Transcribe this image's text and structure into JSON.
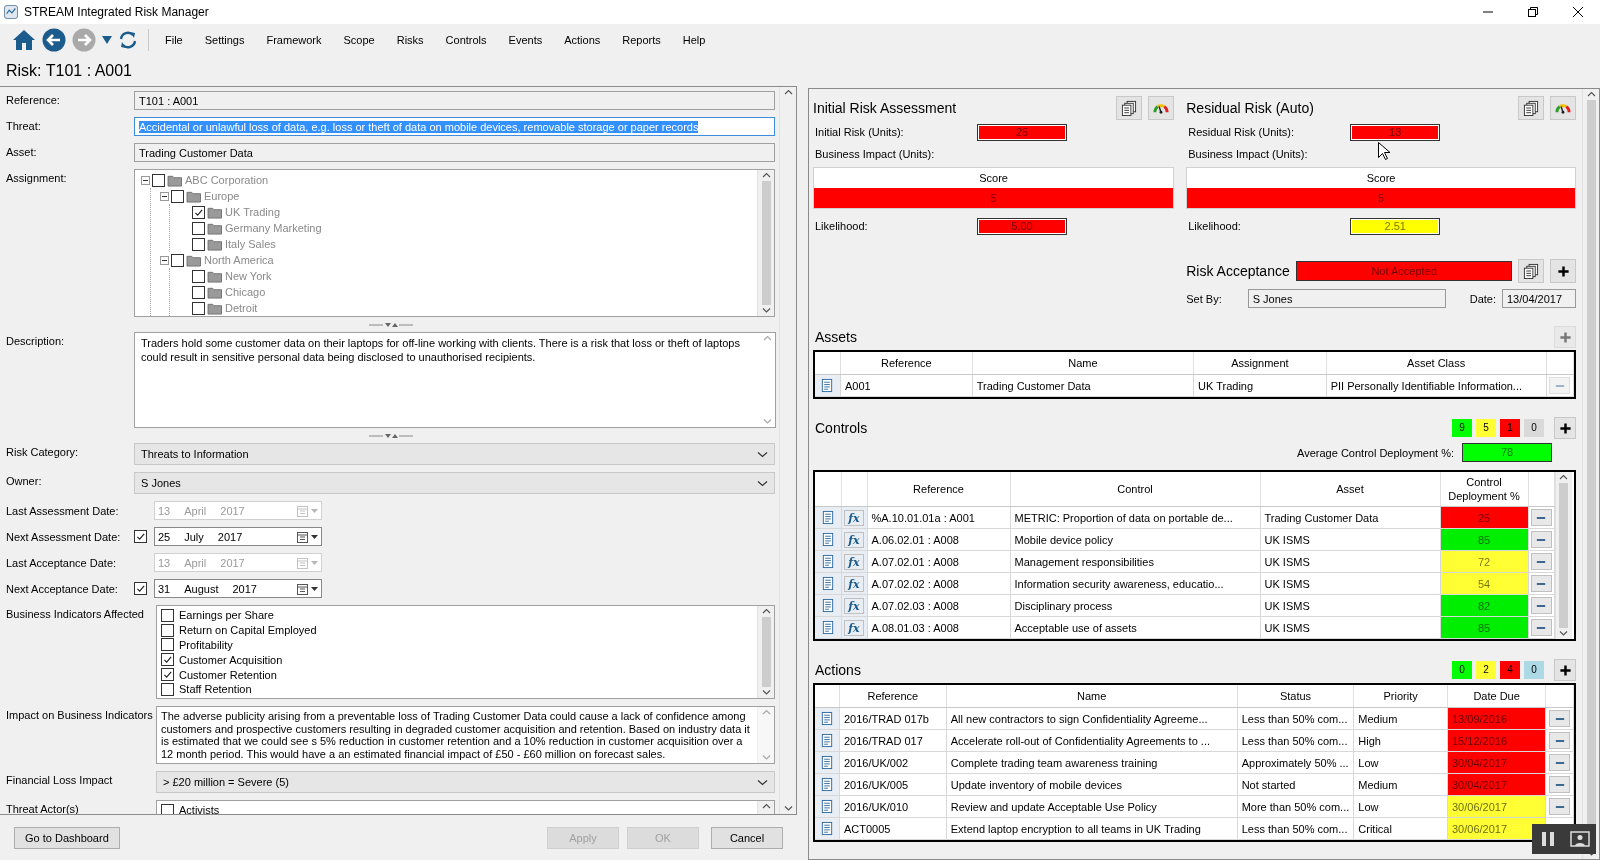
{
  "window": {
    "title": "STREAM Integrated Risk Manager"
  },
  "menu": [
    "File",
    "Settings",
    "Framework",
    "Scope",
    "Risks",
    "Controls",
    "Events",
    "Actions",
    "Reports",
    "Help"
  ],
  "page_title": "Risk: T101 : A001",
  "form": {
    "reference": {
      "label": "Reference:",
      "value": "T101 : A001"
    },
    "threat": {
      "label": "Threat:",
      "value": "Accidental or unlawful loss of data, e.g. loss or theft of data on mobile devices, removable storage or paper records",
      "selected": true
    },
    "asset": {
      "label": "Asset:",
      "value": "Trading Customer Data"
    },
    "assignment": {
      "label": "Assignment:",
      "tree": [
        {
          "label": "ABC Corporation",
          "checked": false,
          "expanded": true,
          "children": [
            {
              "label": "Europe",
              "checked": false,
              "expanded": true,
              "children": [
                {
                  "label": "UK Trading",
                  "checked": true
                },
                {
                  "label": "Germany Marketing",
                  "checked": false
                },
                {
                  "label": "Italy Sales",
                  "checked": false
                }
              ]
            },
            {
              "label": "North America",
              "checked": false,
              "expanded": true,
              "children": [
                {
                  "label": "New York",
                  "checked": false
                },
                {
                  "label": "Chicago",
                  "checked": false
                },
                {
                  "label": "Detroit",
                  "checked": false
                }
              ]
            }
          ]
        }
      ]
    },
    "description": {
      "label": "Description:",
      "value": "Traders hold some customer data on their laptops for off-line working with clients.  There is a risk that loss or theft of laptops could result in sensitive personal data being disclosed to unauthorised recipients."
    },
    "risk_category": {
      "label": "Risk Category:",
      "value": "Threats to Information"
    },
    "owner": {
      "label": "Owner:",
      "value": "S Jones"
    },
    "dates": [
      {
        "label": "Last Assessment Date:",
        "day": "13",
        "month": "April",
        "year": "2017",
        "disabled": true
      },
      {
        "label": "Next Assessment Date:",
        "day": "25",
        "month": "July",
        "year": "2017",
        "disabled": false,
        "checked": true
      },
      {
        "label": "Last Acceptance Date:",
        "day": "13",
        "month": "April",
        "year": "2017",
        "disabled": true
      },
      {
        "label": "Next Acceptance Date:",
        "day": "31",
        "month": "August",
        "year": "2017",
        "disabled": false,
        "checked": true
      }
    ],
    "business_indicators": {
      "label": "Business Indicators Affected",
      "items": [
        {
          "label": "Earnings per Share",
          "checked": false
        },
        {
          "label": "Return on Capital Employed",
          "checked": false
        },
        {
          "label": "Profitability",
          "checked": false
        },
        {
          "label": "Customer Acquisition",
          "checked": true
        },
        {
          "label": "Customer Retention",
          "checked": true
        },
        {
          "label": "Staff Retention",
          "checked": false
        }
      ]
    },
    "impact": {
      "label": "Impact on Business Indicators",
      "value": "The adverse publicity arising from a preventable loss of Trading Customer Data could cause a lack of confidence among customers and prospective customers resulting in degraded customer acquisition and retention.  Based on industry data it is estimated that we could see s 5% reduction in customer retention and a 10% reduction in customer acquisition over a 12 month period.  This would have a an estimated financial impact of £50 - £60 million on forecast sales."
    },
    "financial_loss": {
      "label": "Financial Loss Impact",
      "value": "> £20 million = Severe (5)"
    },
    "threat_actors": {
      "label": "Threat Actor(s)",
      "items": [
        {
          "label": "Activists",
          "checked": false
        }
      ]
    }
  },
  "footer_buttons": [
    {
      "label": "Go to Dashboard",
      "disabled": false
    },
    {
      "label": "Apply",
      "disabled": true
    },
    {
      "label": "OK",
      "disabled": true
    },
    {
      "label": "Cancel",
      "disabled": false
    }
  ],
  "assessments": [
    {
      "title": "Initial Risk Assessment",
      "risk_label": "Initial Risk (Units):",
      "risk": {
        "value": "25",
        "color": "#ff0000"
      },
      "impact_label": "Business Impact (Units):",
      "score_header": "Score",
      "score": {
        "value": "5",
        "color": "#ff0000"
      },
      "likelihood_label": "Likelihood:",
      "likelihood": {
        "value": "5.00",
        "color": "#ff0000"
      }
    },
    {
      "title": "Residual Risk (Auto)",
      "risk_label": "Residual Risk (Units):",
      "risk": {
        "value": "13",
        "color": "#ff0000"
      },
      "impact_label": "Business Impact (Units):",
      "score_header": "Score",
      "score": {
        "value": "5",
        "color": "#ff0000"
      },
      "likelihood_label": "Likelihood:",
      "likelihood": {
        "value": "2.51",
        "color": "#ffff00"
      }
    }
  ],
  "risk_acceptance": {
    "title": "Risk Acceptance",
    "status": {
      "value": "Not Accepted",
      "color": "#ff0000"
    },
    "set_by_label": "Set By:",
    "set_by": "S Jones",
    "date_label": "Date:",
    "date": "13/04/2017"
  },
  "assets": {
    "title": "Assets",
    "columns": [
      "Reference",
      "Name",
      "Assignment",
      "Asset Class"
    ],
    "rows": [
      {
        "cells": [
          "A001",
          "Trading Customer Data",
          "UK Trading",
          "PII Personally Identifiable Information..."
        ]
      }
    ]
  },
  "controls": {
    "title": "Controls",
    "counts": [
      {
        "value": "9",
        "color": "#00ff00"
      },
      {
        "value": "5",
        "color": "#ffff33"
      },
      {
        "value": "1",
        "color": "#ff0000"
      },
      {
        "value": "0",
        "color": "#d9d9d9"
      }
    ],
    "average_label": "Average Control Deployment %:",
    "average": {
      "value": "78",
      "color": "#00ff00"
    },
    "columns": [
      "Reference",
      "Control",
      "Asset",
      "Control Deployment %"
    ],
    "rows": [
      {
        "formula": "fx",
        "reference": "%A.10.01.01a : A001",
        "control": "METRIC: Proportion of data on portable de...",
        "asset": "Trading Customer Data",
        "deployment": "25",
        "color": "#ff0000"
      },
      {
        "formula": "fx",
        "reference": "A.06.02.01 : A008",
        "control": "Mobile device policy",
        "asset": "UK ISMS",
        "deployment": "85",
        "color": "#00ee00"
      },
      {
        "formula": "fx",
        "reference": "A.07.02.01 : A008",
        "control": "Management responsibilities",
        "asset": "UK ISMS",
        "deployment": "72",
        "color": "#ffff33"
      },
      {
        "formula": "fx",
        "reference": "A.07.02.02 : A008",
        "control": "Information security awareness, educatio...",
        "asset": "UK ISMS",
        "deployment": "54",
        "color": "#ffff33"
      },
      {
        "formula": "fx",
        "reference": "A.07.02.03 : A008",
        "control": "Disciplinary process",
        "asset": "UK ISMS",
        "deployment": "82",
        "color": "#00ee00"
      },
      {
        "formula": "fx",
        "reference": "A.08.01.03 : A008",
        "control": "Acceptable use of assets",
        "asset": "UK ISMS",
        "deployment": "85",
        "color": "#00ee00"
      }
    ]
  },
  "actions": {
    "title": "Actions",
    "counts": [
      {
        "value": "0",
        "color": "#00ff00"
      },
      {
        "value": "2",
        "color": "#ffff33"
      },
      {
        "value": "4",
        "color": "#ff0000"
      },
      {
        "value": "0",
        "color": "#add8e6"
      }
    ],
    "columns": [
      "Reference",
      "Name",
      "Status",
      "Priority",
      "Date Due"
    ],
    "rows": [
      {
        "reference": "2016/TRAD 017b",
        "name": "All new contractors to sign Confidentiality Agreeme...",
        "status": "Less than 50% com...",
        "priority": "Medium",
        "date_due": "13/09/2016",
        "color": "#ff0000",
        "remove_button": true
      },
      {
        "reference": "2016/TRAD 017",
        "name": "Accelerate roll-out of Confidentiality Agreements to ...",
        "status": "Less than 50% com...",
        "priority": "High",
        "date_due": "15/12/2016",
        "color": "#ff0000",
        "remove_button": true
      },
      {
        "reference": "2016/UK/002",
        "name": "Complete trading team awareness training",
        "status": "Approximately 50% ...",
        "priority": "Low",
        "date_due": "30/04/2017",
        "color": "#ff0000",
        "remove_button": true
      },
      {
        "reference": "2016/UK/005",
        "name": "Update inventory of mobile devices",
        "status": "Not started",
        "priority": "Medium",
        "date_due": "30/04/2017",
        "color": "#ff0000",
        "remove_button": true
      },
      {
        "reference": "2016/UK/010",
        "name": "Review and update Acceptable Use Policy",
        "status": "More than 50% com...",
        "priority": "Low",
        "date_due": "30/06/2017",
        "color": "#ffff33",
        "remove_button": true
      },
      {
        "reference": "ACT0005",
        "name": "Extend laptop encryption to all teams in UK Trading",
        "status": "Less than 50% com...",
        "priority": "Critical",
        "date_due": "30/06/2017",
        "color": "#ffff33",
        "remove_button": false
      }
    ]
  }
}
